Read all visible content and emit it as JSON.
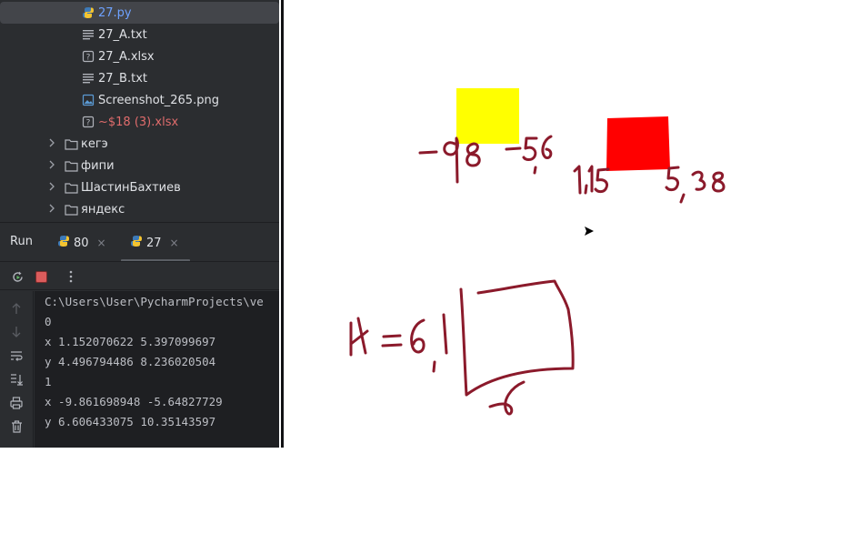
{
  "project_tree": {
    "items": [
      {
        "label": "27.py",
        "icon": "python-file-icon",
        "kind": "file",
        "color": "#6ea2ff",
        "selected": true
      },
      {
        "label": "27_A.txt",
        "icon": "text-file-icon",
        "kind": "file"
      },
      {
        "label": "27_A.xlsx",
        "icon": "unknown-file-icon",
        "kind": "file"
      },
      {
        "label": "27_B.txt",
        "icon": "text-file-icon",
        "kind": "file"
      },
      {
        "label": "Screenshot_265.png",
        "icon": "image-file-icon",
        "kind": "file"
      },
      {
        "label": "~$18 (3).xlsx",
        "icon": "unknown-file-icon",
        "kind": "file",
        "color": "#e06c6c"
      },
      {
        "label": "кегэ",
        "icon": "folder-icon",
        "kind": "folder"
      },
      {
        "label": "фипи",
        "icon": "folder-icon",
        "kind": "folder"
      },
      {
        "label": "ШастинБахтиев",
        "icon": "folder-icon",
        "kind": "folder"
      },
      {
        "label": "яндекс",
        "icon": "folder-icon",
        "kind": "folder"
      }
    ]
  },
  "run_panel": {
    "title": "Run",
    "tabs": [
      {
        "label": "80",
        "icon": "python-icon",
        "close": "×"
      },
      {
        "label": "27",
        "icon": "python-icon",
        "close": "×",
        "active": true
      }
    ],
    "actions": [
      "rerun-icon",
      "stop-icon",
      "more-options-icon"
    ],
    "gutter": [
      "arrow-up-icon",
      "arrow-down-icon",
      "soft-wrap-icon",
      "scroll-to-end-icon",
      "print-icon",
      "trash-icon"
    ]
  },
  "console": {
    "lines": [
      "C:\\Users\\User\\PycharmProjects\\ve",
      "0",
      "x 1.152070622 5.397099697",
      "y 4.496794486 8.236020504",
      "1",
      "x -9.861698948 -5.64827729",
      "y 6.606433075 10.35143597"
    ]
  },
  "whiteboard": {
    "colors": {
      "yellow": "#ffff00",
      "red": "#ff0000",
      "ink": "#8b1a2b"
    }
  }
}
